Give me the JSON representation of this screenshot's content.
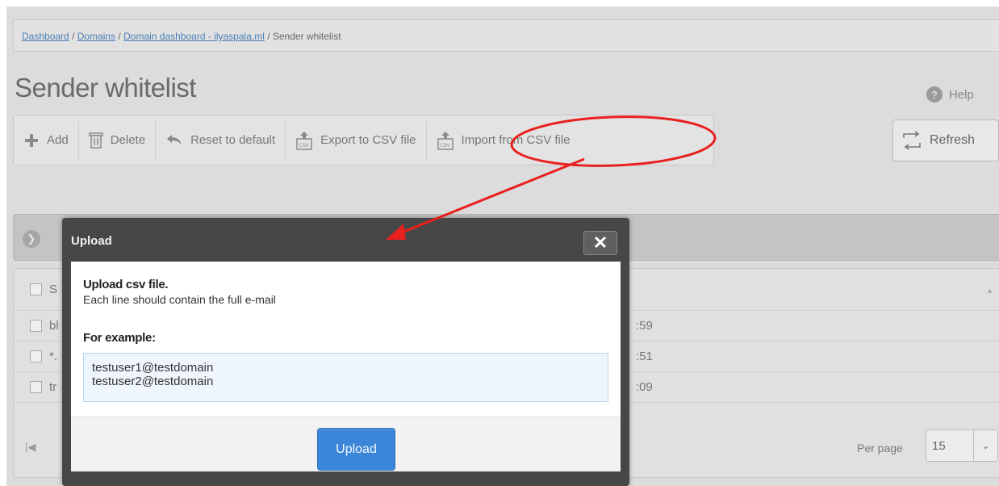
{
  "breadcrumb": {
    "dashboard": "Dashboard",
    "sep1": " / ",
    "domains": "Domains",
    "sep2": " / ",
    "domain_dashboard": "Domain dashboard - ilyaspala.ml",
    "sep3": " / ",
    "current": "Sender whitelist"
  },
  "page": {
    "title": "Sender whitelist"
  },
  "help": {
    "icon_text": "?",
    "label": "Help"
  },
  "toolbar": {
    "add": "Add",
    "delete": "Delete",
    "reset": "Reset to default",
    "export": "Export to CSV file",
    "import": "Import from CSV file"
  },
  "refresh": {
    "label": "Refresh"
  },
  "grid": {
    "header_first_letter": "S",
    "rows": [
      {
        "text": "bl",
        "time": ":59"
      },
      {
        "text": "*.",
        "time": ":51"
      },
      {
        "text": "tr",
        "time": ":09"
      }
    ],
    "per_page_label": "Per page",
    "per_page_value": "15"
  },
  "modal": {
    "title": "Upload",
    "close": "✕",
    "heading": "Upload csv file.",
    "description": "Each line should contain the full e-mail",
    "example_label": "For example:",
    "example_lines": [
      "testuser1@testdomain",
      "testuser2@testdomain"
    ],
    "upload_button": "Upload"
  },
  "colors": {
    "annotation_red": "#e8201e",
    "upload_blue": "#3b86d8",
    "modal_dark": "#474747"
  }
}
